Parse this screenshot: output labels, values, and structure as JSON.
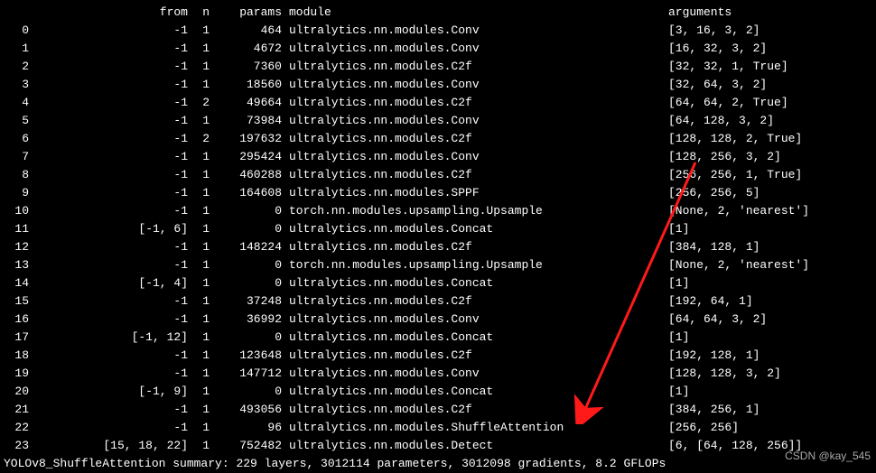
{
  "headers": {
    "from": "from",
    "n": "n",
    "params": "params",
    "module": "module",
    "arguments": "arguments"
  },
  "rows": [
    {
      "idx": "0",
      "from": "-1",
      "n": "1",
      "params": "464",
      "module": "ultralytics.nn.modules.Conv",
      "args": "[3, 16, 3, 2]"
    },
    {
      "idx": "1",
      "from": "-1",
      "n": "1",
      "params": "4672",
      "module": "ultralytics.nn.modules.Conv",
      "args": "[16, 32, 3, 2]"
    },
    {
      "idx": "2",
      "from": "-1",
      "n": "1",
      "params": "7360",
      "module": "ultralytics.nn.modules.C2f",
      "args": "[32, 32, 1, True]"
    },
    {
      "idx": "3",
      "from": "-1",
      "n": "1",
      "params": "18560",
      "module": "ultralytics.nn.modules.Conv",
      "args": "[32, 64, 3, 2]"
    },
    {
      "idx": "4",
      "from": "-1",
      "n": "2",
      "params": "49664",
      "module": "ultralytics.nn.modules.C2f",
      "args": "[64, 64, 2, True]"
    },
    {
      "idx": "5",
      "from": "-1",
      "n": "1",
      "params": "73984",
      "module": "ultralytics.nn.modules.Conv",
      "args": "[64, 128, 3, 2]"
    },
    {
      "idx": "6",
      "from": "-1",
      "n": "2",
      "params": "197632",
      "module": "ultralytics.nn.modules.C2f",
      "args": "[128, 128, 2, True]"
    },
    {
      "idx": "7",
      "from": "-1",
      "n": "1",
      "params": "295424",
      "module": "ultralytics.nn.modules.Conv",
      "args": "[128, 256, 3, 2]"
    },
    {
      "idx": "8",
      "from": "-1",
      "n": "1",
      "params": "460288",
      "module": "ultralytics.nn.modules.C2f",
      "args": "[256, 256, 1, True]"
    },
    {
      "idx": "9",
      "from": "-1",
      "n": "1",
      "params": "164608",
      "module": "ultralytics.nn.modules.SPPF",
      "args": "[256, 256, 5]"
    },
    {
      "idx": "10",
      "from": "-1",
      "n": "1",
      "params": "0",
      "module": "torch.nn.modules.upsampling.Upsample",
      "args": "[None, 2, 'nearest']"
    },
    {
      "idx": "11",
      "from": "[-1, 6]",
      "n": "1",
      "params": "0",
      "module": "ultralytics.nn.modules.Concat",
      "args": "[1]"
    },
    {
      "idx": "12",
      "from": "-1",
      "n": "1",
      "params": "148224",
      "module": "ultralytics.nn.modules.C2f",
      "args": "[384, 128, 1]"
    },
    {
      "idx": "13",
      "from": "-1",
      "n": "1",
      "params": "0",
      "module": "torch.nn.modules.upsampling.Upsample",
      "args": "[None, 2, 'nearest']"
    },
    {
      "idx": "14",
      "from": "[-1, 4]",
      "n": "1",
      "params": "0",
      "module": "ultralytics.nn.modules.Concat",
      "args": "[1]"
    },
    {
      "idx": "15",
      "from": "-1",
      "n": "1",
      "params": "37248",
      "module": "ultralytics.nn.modules.C2f",
      "args": "[192, 64, 1]"
    },
    {
      "idx": "16",
      "from": "-1",
      "n": "1",
      "params": "36992",
      "module": "ultralytics.nn.modules.Conv",
      "args": "[64, 64, 3, 2]"
    },
    {
      "idx": "17",
      "from": "[-1, 12]",
      "n": "1",
      "params": "0",
      "module": "ultralytics.nn.modules.Concat",
      "args": "[1]"
    },
    {
      "idx": "18",
      "from": "-1",
      "n": "1",
      "params": "123648",
      "module": "ultralytics.nn.modules.C2f",
      "args": "[192, 128, 1]"
    },
    {
      "idx": "19",
      "from": "-1",
      "n": "1",
      "params": "147712",
      "module": "ultralytics.nn.modules.Conv",
      "args": "[128, 128, 3, 2]"
    },
    {
      "idx": "20",
      "from": "[-1, 9]",
      "n": "1",
      "params": "0",
      "module": "ultralytics.nn.modules.Concat",
      "args": "[1]"
    },
    {
      "idx": "21",
      "from": "-1",
      "n": "1",
      "params": "493056",
      "module": "ultralytics.nn.modules.C2f",
      "args": "[384, 256, 1]"
    },
    {
      "idx": "22",
      "from": "-1",
      "n": "1",
      "params": "96",
      "module": "ultralytics.nn.modules.ShuffleAttention",
      "args": "[256, 256]"
    },
    {
      "idx": "23",
      "from": "[15, 18, 22]",
      "n": "1",
      "params": "752482",
      "module": "ultralytics.nn.modules.Detect",
      "args": "[6, [64, 128, 256]]"
    }
  ],
  "summary": "YOLOv8_ShuffleAttention summary: 229 layers, 3012114 parameters, 3012098 gradients, 8.2 GFLOPs",
  "watermark": "CSDN @kay_545"
}
